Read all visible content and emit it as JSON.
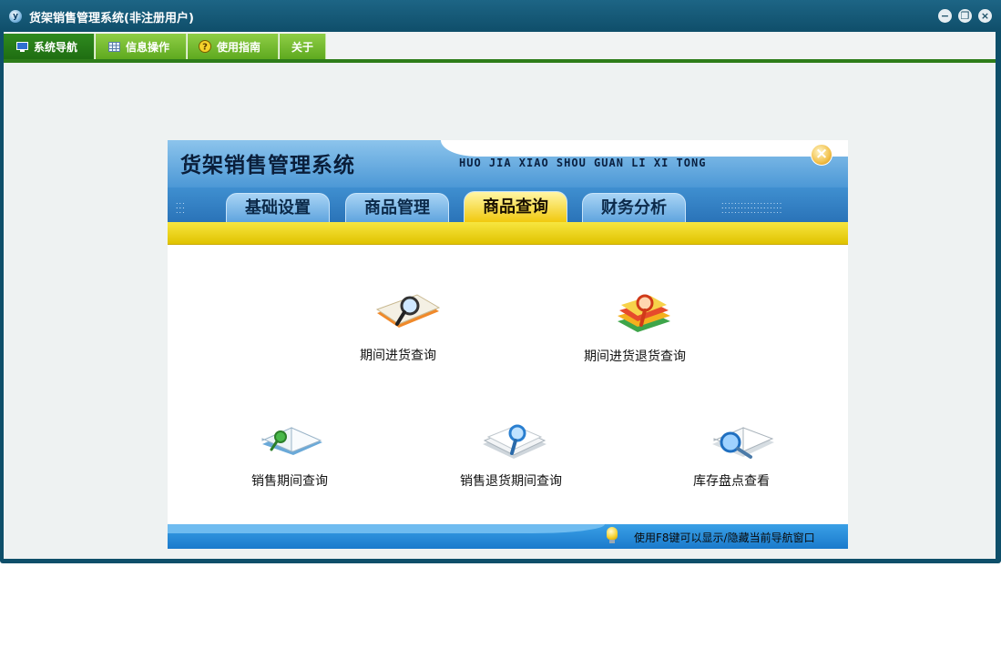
{
  "window": {
    "title": "货架销售管理系统(非注册用户)",
    "app_icon": "y",
    "controls": {
      "minimize": "−",
      "restore": "❐",
      "close": "×"
    }
  },
  "menubar": {
    "items": [
      {
        "label": "系统导航",
        "icon": "monitor-icon"
      },
      {
        "label": "信息操作",
        "icon": "grid-icon"
      },
      {
        "label": "使用指南",
        "icon": "help-icon"
      },
      {
        "label": "关于",
        "icon": ""
      }
    ]
  },
  "panel": {
    "title": "货架销售管理系统",
    "pinyin": "HUO JIA XIAO SHOU GUAN LI XI TONG",
    "close_glyph": "×",
    "tabs": [
      {
        "label": "基础设置",
        "active": false
      },
      {
        "label": "商品管理",
        "active": false
      },
      {
        "label": "商品查询",
        "active": true
      },
      {
        "label": "财务分析",
        "active": false
      }
    ],
    "items": [
      {
        "label": "期间进货查询",
        "icon": "magnifier-book-icon"
      },
      {
        "label": "期间进货退货查询",
        "icon": "book-stack-magnifier-icon"
      },
      {
        "label": "销售期间查询",
        "icon": "open-book-icon"
      },
      {
        "label": "销售退货期间查询",
        "icon": "papers-magnifier-icon"
      },
      {
        "label": "库存盘点查看",
        "icon": "book-search-icon"
      }
    ],
    "footer_tip": "使用F8键可以显示/隐藏当前导航窗口"
  },
  "colors": {
    "titlebar": "#0f4e6a",
    "menu_green": "#5ea91f",
    "menu_active": "#1f6e12",
    "panel_blue": "#4c98d6",
    "tab_active": "#f1c90e",
    "stripe_yellow": "#e0c300"
  }
}
